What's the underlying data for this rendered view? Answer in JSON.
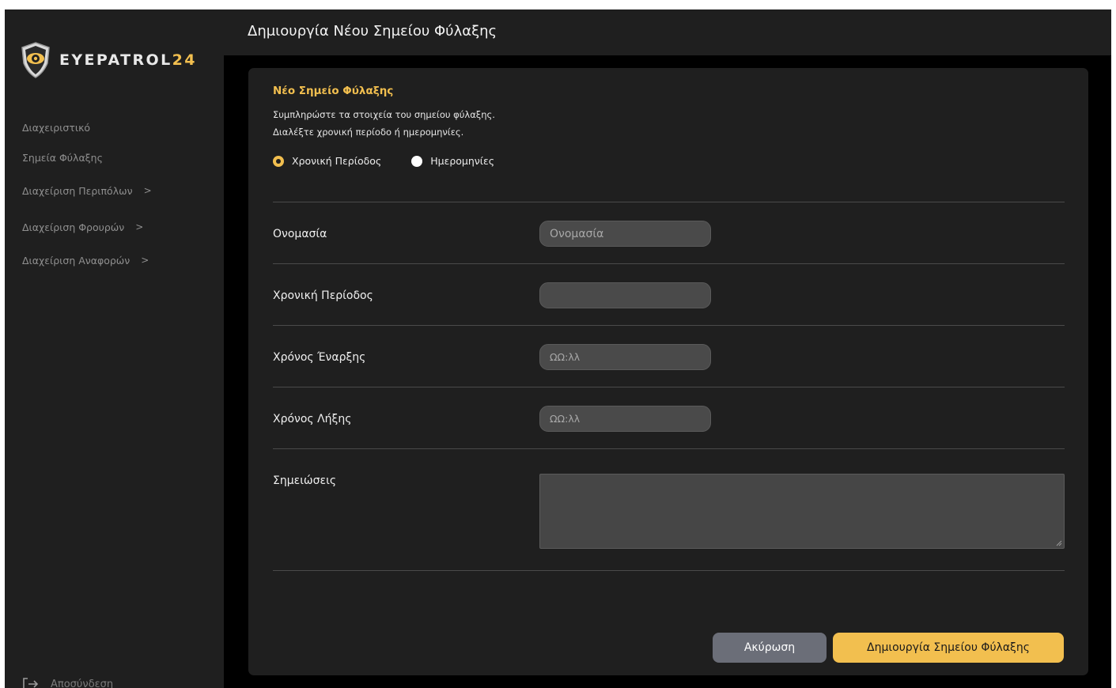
{
  "brand": {
    "name_main": "EYEPATROL",
    "name_suffix": "24",
    "accent_color": "#f2bf4f"
  },
  "sidebar": {
    "items": [
      {
        "label": "Διαχειριστικό",
        "chevron": ""
      },
      {
        "label": "Σημεία Φύλαξης",
        "chevron": ""
      },
      {
        "label": "Διαχείριση Περιπόλων",
        "chevron": ">"
      },
      {
        "label": "Διαχείριση Φρουρών",
        "chevron": ">"
      },
      {
        "label": "Διαχείριση Αναφορών",
        "chevron": ">"
      }
    ],
    "logout_label": "Αποσύνδεση",
    "logout_icon": "logout-icon"
  },
  "header": {
    "title": "Δημιουργία Νέου Σημείου Φύλαξης"
  },
  "form": {
    "title": "Νέο Σημείο Φύλαξης",
    "description_line1": "Συμπληρώστε τα στοιχεία του σημείου φύλαξης.",
    "description_line2": "Διαλέξτε χρονική περίοδο ή ημερομηνίες.",
    "radio_options": [
      {
        "label": "Χρονική Περίοδος",
        "checked": true
      },
      {
        "label": "Ημερομηνίες",
        "checked": false
      }
    ],
    "fields": {
      "name": {
        "label": "Ονομασία",
        "placeholder": "Ονομασία",
        "value": ""
      },
      "period": {
        "label": "Χρονική Περίοδος",
        "placeholder": "",
        "value": ""
      },
      "start_time": {
        "label": "Χρόνος Έναρξης",
        "placeholder": "ΩΩ:λλ",
        "value": ""
      },
      "end_time": {
        "label": "Χρόνος Λήξης",
        "placeholder": "ΩΩ:λλ",
        "value": ""
      },
      "notes": {
        "label": "Σημειώσεις",
        "value": ""
      }
    },
    "buttons": {
      "cancel": "Ακύρωση",
      "create": "Δημιουργία Σημείου Φύλαξης"
    }
  }
}
